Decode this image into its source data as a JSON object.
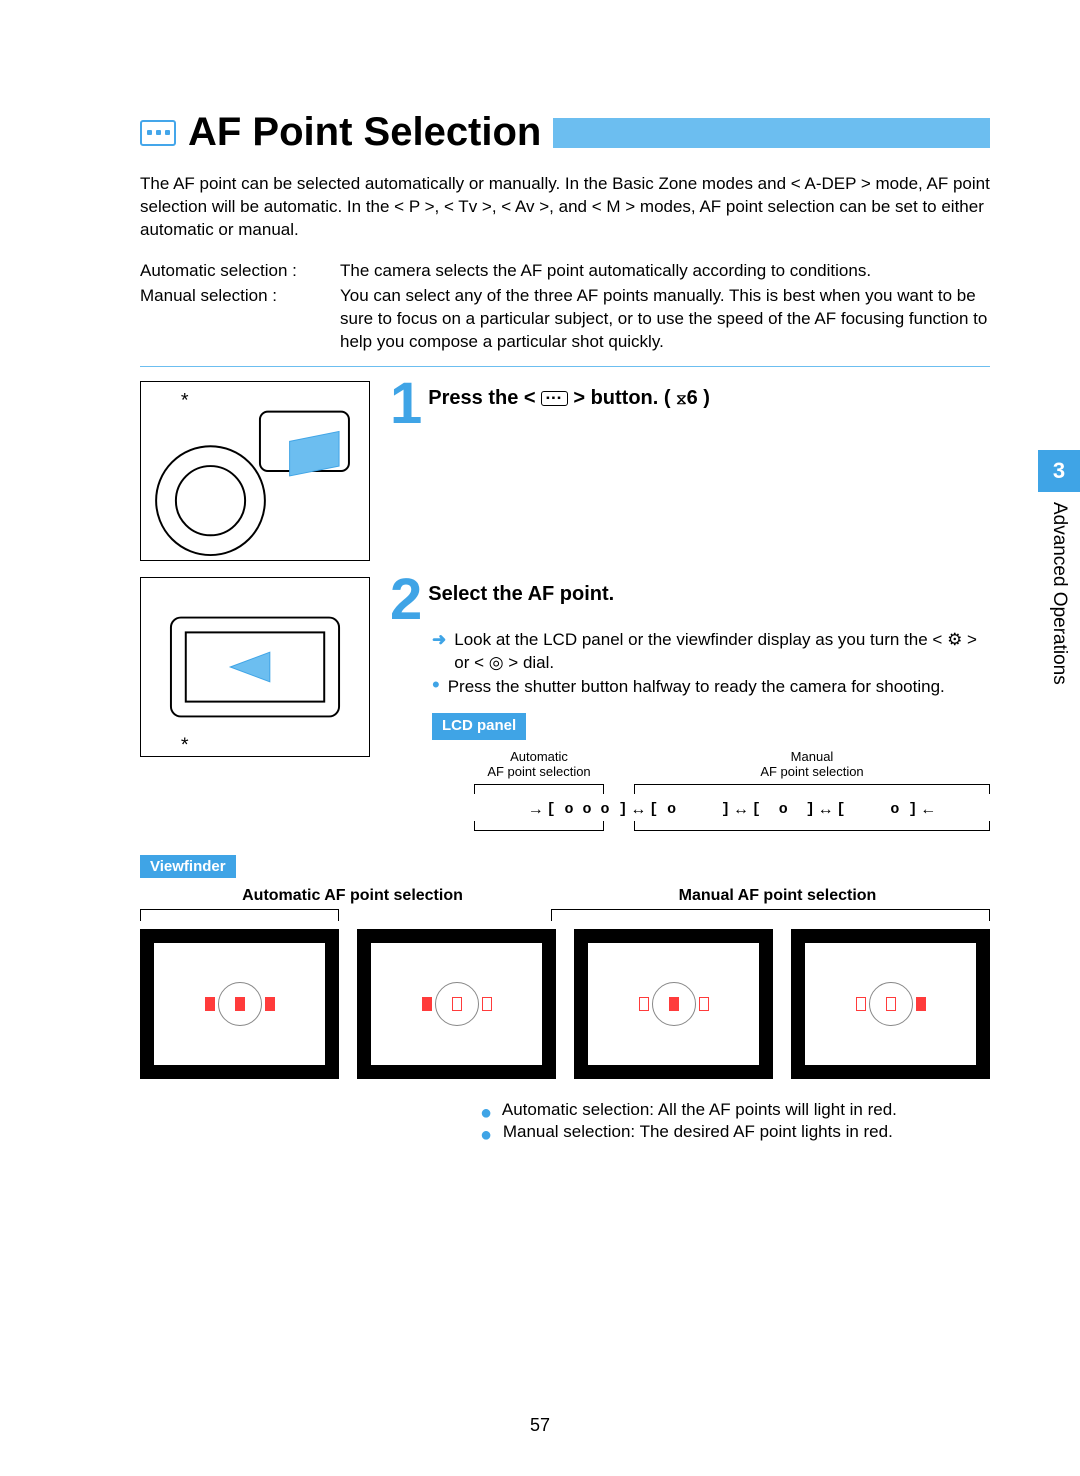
{
  "title": "AF Point Selection",
  "intro": "The AF point can be selected automatically or manually. In the Basic Zone modes and < A-DEP > mode, AF point selection will be automatic. In the < P >, < Tv >, < Av >, and < M > modes, AF point selection can be set to either automatic or manual.",
  "defs": {
    "auto_label": "Automatic selection :",
    "auto_desc": "The camera selects the AF point automatically according to conditions.",
    "manual_label": "Manual selection :",
    "manual_desc": "You can select any of the three AF points manually. This is best when you want to be sure to focus on a particular subject, or to use the speed of the AF focusing function to help you compose a particular shot quickly."
  },
  "step1": {
    "num": "1",
    "head_a": "Press the <",
    "head_b": "> button. (",
    "head_c": "6 )"
  },
  "step2": {
    "num": "2",
    "head": "Select the AF point.",
    "b1": "Look at the LCD panel or the viewfinder display as you turn the < ⚙ > or < ◎ > dial.",
    "b2": "Press the shutter button halfway to ready the camera for shooting."
  },
  "lcd": {
    "label": "LCD panel",
    "auto_head": "Automatic\nAF point selection",
    "manual_head": "Manual\nAF point selection"
  },
  "viewfinder": {
    "label": "Viewfinder",
    "auto_title": "Automatic AF point selection",
    "manual_title": "Manual AF point selection",
    "note1a": "Automatic selection:",
    "note1b": "All the AF points will light in red.",
    "note2a": "Manual selection:",
    "note2b": "The desired AF point lights in red."
  },
  "side": {
    "chapter_num": "3",
    "chapter_title": "Advanced Operations"
  },
  "page_number": "57"
}
